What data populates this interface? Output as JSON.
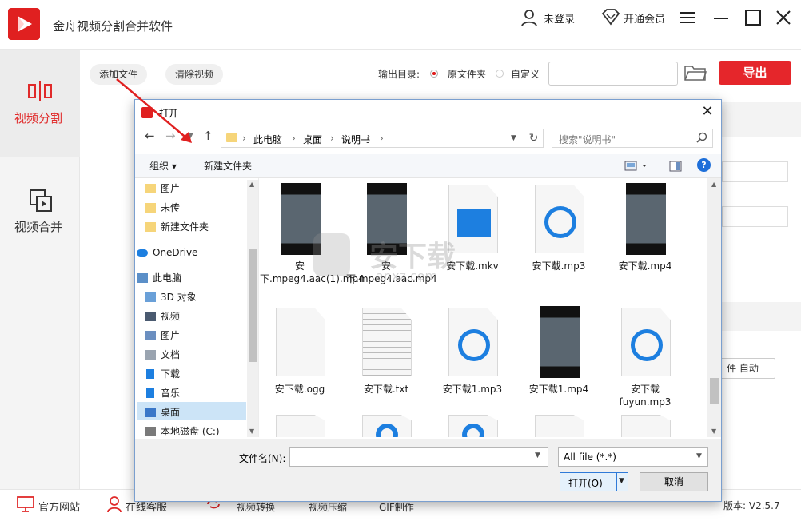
{
  "app": {
    "title": "金舟视频分割合并软件",
    "user_label": "未登录",
    "vip_label": "开通会员",
    "accent_color": "#e02020"
  },
  "sidebar": {
    "items": [
      {
        "label": "视频分割",
        "active": true
      },
      {
        "label": "视频合并",
        "active": false
      }
    ]
  },
  "toolbar": {
    "add_file": "添加文件",
    "clear_video": "清除视频",
    "output_dir_label": "输出目录:",
    "radio_source": "原文件夹",
    "radio_custom": "自定义",
    "export": "导出"
  },
  "right_fragment": "件 自动",
  "bottom": {
    "official_site": "官方网站",
    "online_service": "在线客服",
    "video_convert": "视频转换",
    "video_compress": "视频压缩",
    "gif_make": "GIF制作",
    "version": "版本: V2.5.7"
  },
  "dialog": {
    "title": "打开",
    "breadcrumb": [
      "此电脑",
      "桌面",
      "说明书"
    ],
    "search_placeholder": "搜索\"说明书\"",
    "organize": "组织 ▾",
    "new_folder": "新建文件夹",
    "tree": [
      {
        "label": "图片",
        "icon": "folder-icon"
      },
      {
        "label": "未传",
        "icon": "folder-icon"
      },
      {
        "label": "新建文件夹",
        "icon": "folder-icon"
      },
      {
        "label": "OneDrive",
        "icon": "cloud-icon"
      },
      {
        "label": "此电脑",
        "icon": "computer-icon"
      },
      {
        "label": "3D 对象",
        "icon": "cube-icon"
      },
      {
        "label": "视频",
        "icon": "film-icon"
      },
      {
        "label": "图片",
        "icon": "picture-icon"
      },
      {
        "label": "文档",
        "icon": "document-icon"
      },
      {
        "label": "下载",
        "icon": "download-icon"
      },
      {
        "label": "音乐",
        "icon": "music-icon"
      },
      {
        "label": "桌面",
        "icon": "desktop-icon"
      },
      {
        "label": "本地磁盘 (C:)",
        "icon": "drive-icon"
      }
    ],
    "files": [
      {
        "label": "安下.mpeg4.aac(1).mp4",
        "kind": "video"
      },
      {
        "label": "安下.mpeg4.aac.mp4",
        "kind": "video"
      },
      {
        "label": "安下载.mkv",
        "kind": "mkv"
      },
      {
        "label": "安下载.mp3",
        "kind": "mp3"
      },
      {
        "label": "安下载.mp4",
        "kind": "video"
      },
      {
        "label": "安下载.ogg",
        "kind": "blank"
      },
      {
        "label": "安下载.txt",
        "kind": "text"
      },
      {
        "label": "安下载1.mp3",
        "kind": "mp3"
      },
      {
        "label": "安下载1.mp4",
        "kind": "video"
      },
      {
        "label": "安下载fuyun.mp3",
        "kind": "mp3"
      }
    ],
    "filename_label": "文件名(N):",
    "filename_value": "",
    "filter_label": "All file (*.*)",
    "open_label": "打开(O)",
    "cancel_label": "取消"
  },
  "watermark": {
    "text": "安下载",
    "sub": "anxz.com"
  }
}
